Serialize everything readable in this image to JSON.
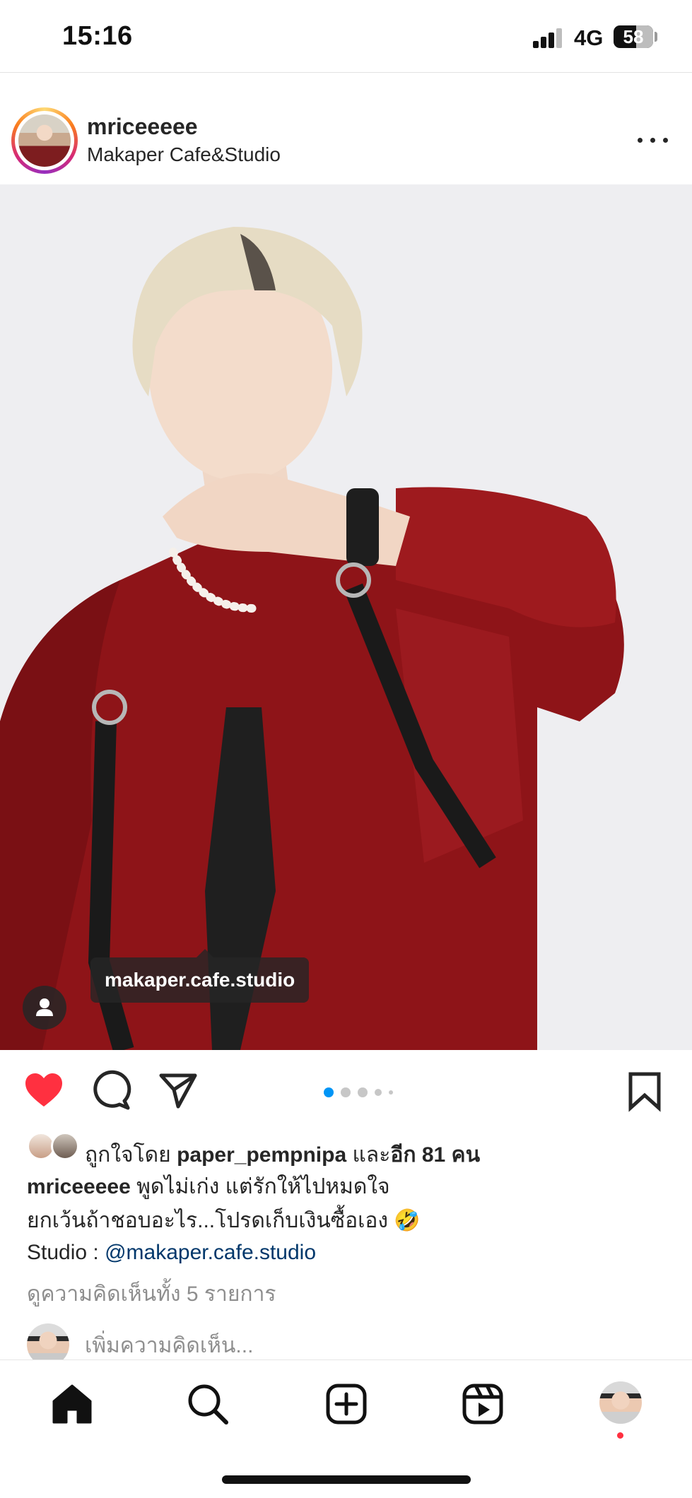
{
  "status_bar": {
    "time": "15:16",
    "network": "4G",
    "battery": "58",
    "battery_level_percent": 58
  },
  "post": {
    "username": "mriceeeee",
    "location": "Makaper Cafe&Studio",
    "photo_tag": "makaper.cafe.studio",
    "carousel": {
      "total": 5,
      "active": 1
    },
    "likes": {
      "prefix": "ถูกใจโดย ",
      "first_liker": "paper_pempnipa",
      "middle": " และ",
      "others": "อีก 81 คน"
    },
    "caption": {
      "username": "mriceeeee",
      "line1": " พูดไม่เก่ง แต่รักให้ไปหมดใจ",
      "line2": "ยกเว้นถ้าชอบอะไร...โปรดเก็บเงินซื้อเอง 🤣",
      "line3_prefix": "Studio : ",
      "line3_mention": "@makaper.cafe.studio"
    },
    "view_comments": "ดูความคิดเห็นทั้ง 5 รายการ",
    "comment_placeholder": "เพิ่มความคิดเห็น..."
  },
  "icons": {
    "like": "heart-icon",
    "comment": "comment-icon",
    "share": "send-icon",
    "save": "bookmark-icon",
    "home": "home-icon",
    "search": "search-icon",
    "create": "plus-square-icon",
    "reels": "reels-icon"
  },
  "colors": {
    "like_red": "#ff3040",
    "mention_blue": "#00376b",
    "carousel_active": "#0095f6",
    "secondary_text": "#8e8e8e"
  }
}
